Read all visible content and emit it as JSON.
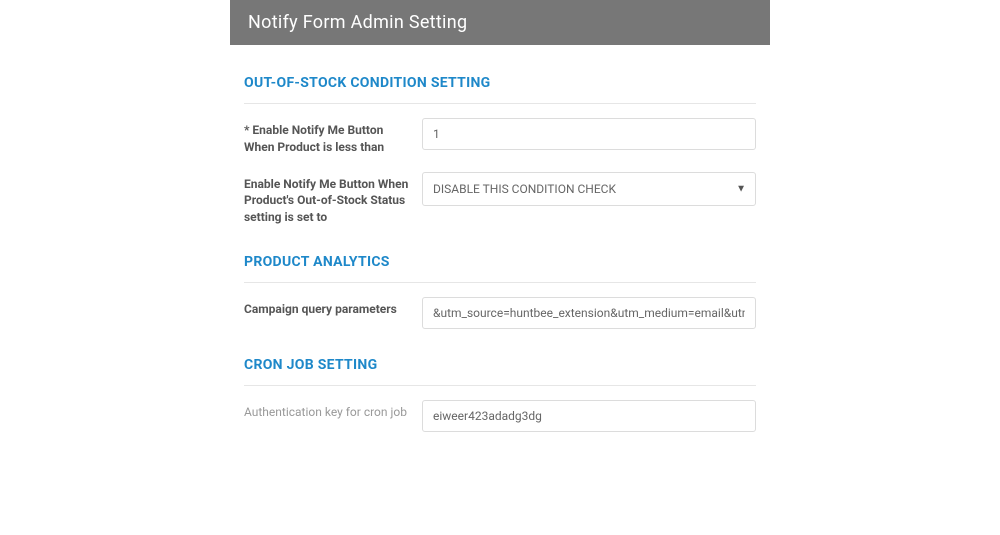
{
  "header": {
    "title": "Notify Form Admin Setting"
  },
  "sections": {
    "outOfStock": {
      "title": "OUT-OF-STOCK CONDITION SETTING",
      "fields": {
        "threshold": {
          "label": "* Enable Notify Me Button When Product is less than",
          "value": "1"
        },
        "status": {
          "label": "Enable Notify Me Button When Product's Out-of-Stock Status setting is set to",
          "selected": "DISABLE THIS CONDITION CHECK"
        }
      }
    },
    "analytics": {
      "title": "PRODUCT ANALYTICS",
      "fields": {
        "campaign": {
          "label": "Campaign query parameters",
          "value": "&utm_source=huntbee_extension&utm_medium=email&utm_campa"
        }
      }
    },
    "cron": {
      "title": "CRON JOB SETTING",
      "fields": {
        "authKey": {
          "label": "Authentication key for cron job",
          "value": "eiweer423adadg3dg"
        }
      }
    }
  }
}
